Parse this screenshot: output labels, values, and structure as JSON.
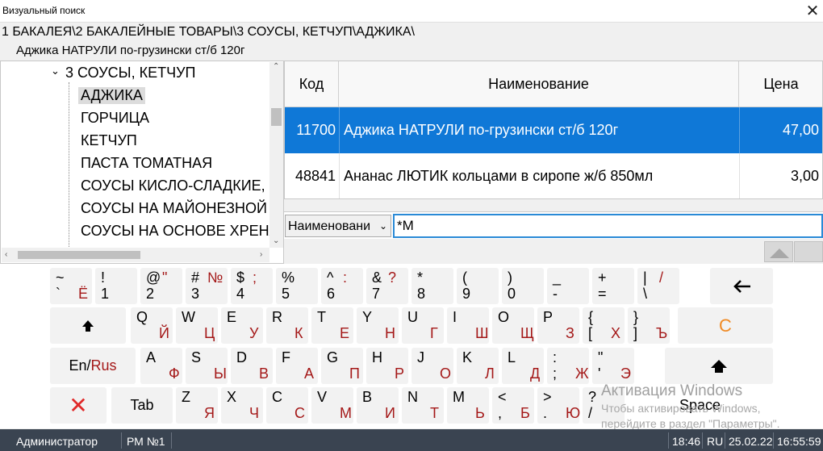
{
  "window": {
    "title": "Визуальный поиск"
  },
  "breadcrumb": {
    "path": "1 БАКАЛЕЯ\\2 БАКАЛЕЙНЫЕ ТОВАРЫ\\3 СОУСЫ, КЕТЧУП\\АДЖИКА\\",
    "item": "Аджика НАТРУЛИ по-грузински ст/б 120г"
  },
  "tree": {
    "parent": "3 СОУСЫ, КЕТЧУП",
    "children": [
      "АДЖИКА",
      "ГОРЧИЦА",
      "КЕТЧУП",
      "ПАСТА ТОМАТНАЯ",
      "СОУСЫ КИСЛО-СЛАДКИЕ,",
      "СОУСЫ НА МАЙОНЕЗНОЙ",
      "СОУСЫ НА ОСНОВЕ ХРЕНА"
    ],
    "selected": "АДЖИКА"
  },
  "grid": {
    "headers": {
      "code": "Код",
      "name": "Наименование",
      "price": "Цена"
    },
    "rows": [
      {
        "code": "11700",
        "name": "Аджика НАТРУЛИ по-грузински ст/б 120г",
        "price": "47,00"
      },
      {
        "code": "48841",
        "name": "Ананас ЛЮТИК кольцами в сиропе ж/б 850мл",
        "price": "3,00"
      }
    ]
  },
  "filter": {
    "field": "Наименовани",
    "value": "*М"
  },
  "keyboard": {
    "row1": [
      [
        "~",
        "`",
        "",
        "Ё"
      ],
      [
        "!",
        "1",
        "",
        ""
      ],
      [
        "@",
        "2",
        "\"",
        ""
      ],
      [
        "#",
        "3",
        "№",
        ""
      ],
      [
        "$",
        "4",
        ";",
        ""
      ],
      [
        "%",
        "5",
        "",
        ""
      ],
      [
        "^",
        "6",
        ":",
        ""
      ],
      [
        "&",
        "7",
        "?",
        ""
      ],
      [
        "*",
        "8",
        "",
        ""
      ],
      [
        "(",
        "9",
        "",
        ""
      ],
      [
        ")",
        "0",
        "",
        ""
      ],
      [
        "_",
        "-",
        "",
        ""
      ],
      [
        "+",
        "=",
        "",
        ""
      ],
      [
        "|",
        "\\",
        "/",
        ""
      ]
    ],
    "row2": [
      [
        "Q",
        "",
        "",
        "Й"
      ],
      [
        "W",
        "",
        "",
        "Ц"
      ],
      [
        "E",
        "",
        "",
        "У"
      ],
      [
        "R",
        "",
        "",
        "К"
      ],
      [
        "T",
        "",
        "",
        "Е"
      ],
      [
        "Y",
        "",
        "",
        "Н"
      ],
      [
        "U",
        "",
        "",
        "Г"
      ],
      [
        "I",
        "",
        "",
        "Ш"
      ],
      [
        "O",
        "",
        "",
        "Щ"
      ],
      [
        "P",
        "",
        "",
        "З"
      ],
      [
        "{",
        "[",
        "",
        "Х"
      ],
      [
        "}",
        "]",
        "",
        "Ъ"
      ]
    ],
    "row3": [
      [
        "A",
        "",
        "",
        "Ф"
      ],
      [
        "S",
        "",
        "",
        "Ы"
      ],
      [
        "D",
        "",
        "",
        "В"
      ],
      [
        "F",
        "",
        "",
        "А"
      ],
      [
        "G",
        "",
        "",
        "П"
      ],
      [
        "H",
        "",
        "",
        "Р"
      ],
      [
        "J",
        "",
        "",
        "О"
      ],
      [
        "K",
        "",
        "",
        "Л"
      ],
      [
        "L",
        "",
        "",
        "Д"
      ],
      [
        ":",
        ";",
        "",
        "Ж"
      ],
      [
        "\"",
        "'",
        "",
        "Э"
      ]
    ],
    "row4": [
      [
        "Z",
        "",
        "",
        "Я"
      ],
      [
        "X",
        "",
        "",
        "Ч"
      ],
      [
        "C",
        "",
        "",
        "С"
      ],
      [
        "V",
        "",
        "",
        "М"
      ],
      [
        "B",
        "",
        "",
        "И"
      ],
      [
        "N",
        "",
        "",
        "Т"
      ],
      [
        "M",
        "",
        "",
        "Ь"
      ],
      [
        "<",
        ",",
        "",
        "Б"
      ],
      [
        ">",
        ".",
        "",
        "Ю"
      ],
      [
        "?",
        "/",
        "",
        ""
      ]
    ],
    "enrus_en": "En/",
    "enrus_ru": "Rus",
    "tab": "Tab",
    "space": "Space",
    "clear": "C",
    "colors": {
      "latin": "#000000",
      "cyrillic": "#a41818",
      "clear": "#f08a24",
      "close": "#e02828"
    }
  },
  "watermark": {
    "title": "Активация Windows",
    "line1": "Чтобы активировать Windows,",
    "line2": "перейдите в раздел \"Параметры\"."
  },
  "status": {
    "user": "Администратор",
    "pos": "РМ №1",
    "clock_short": "18:46",
    "lang": "RU",
    "date": "25.02.22",
    "time": "16:55:59"
  }
}
